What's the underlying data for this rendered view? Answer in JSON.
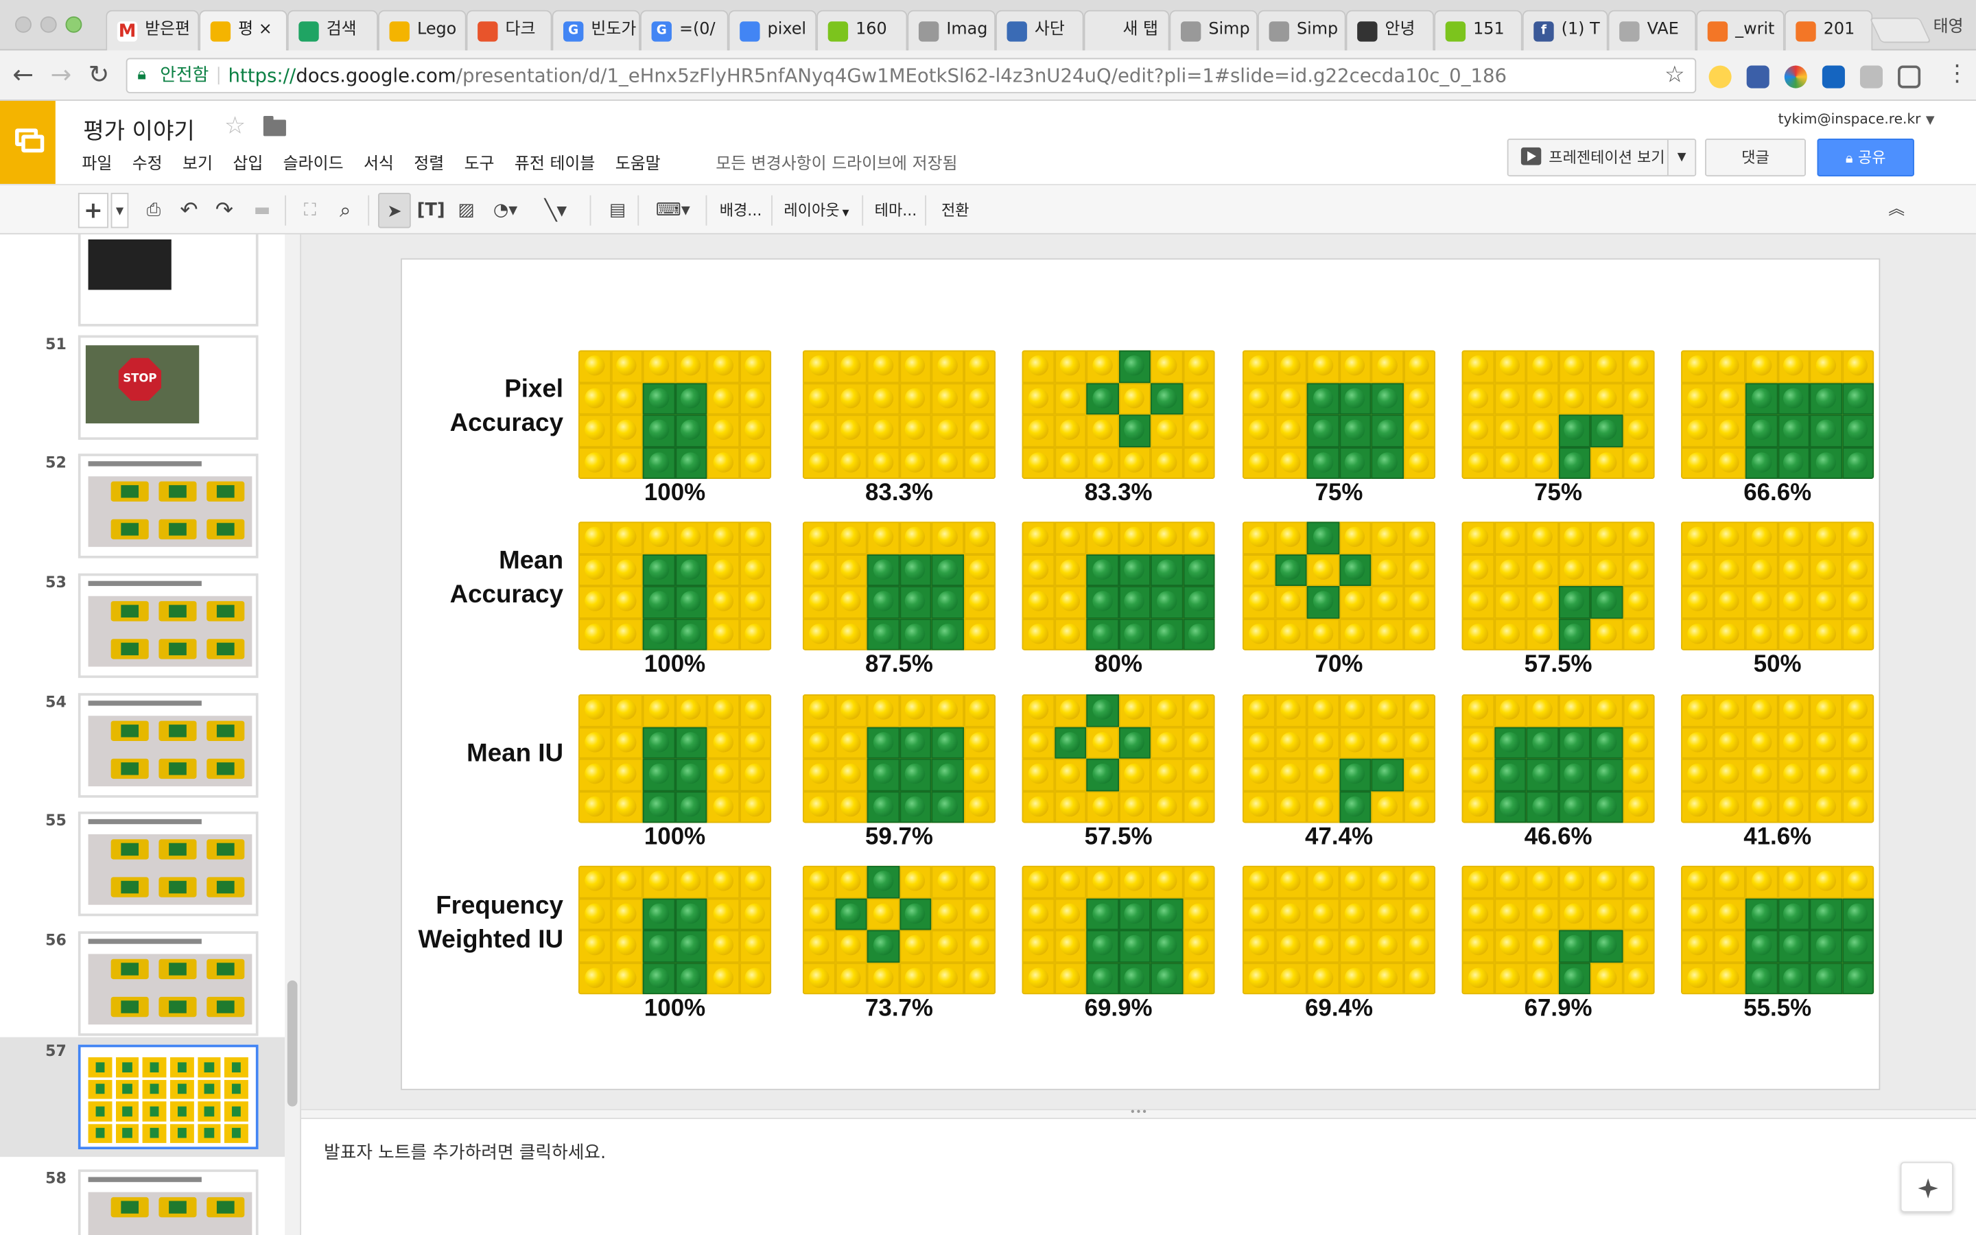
{
  "browser": {
    "tabs": [
      {
        "title": "받은편",
        "icon": "gmail-icon",
        "color": "#ffffff",
        "glyph": "M"
      },
      {
        "title": "평 ×",
        "icon": "slides-icon",
        "color": "#f4b400",
        "glyph": "",
        "active": true
      },
      {
        "title": "검색 ",
        "icon": "drive-icon",
        "color": "#1fa463",
        "glyph": ""
      },
      {
        "title": "Lego",
        "icon": "slides-icon",
        "color": "#f4b400",
        "glyph": ""
      },
      {
        "title": "다크 ",
        "icon": "brave-icon",
        "color": "#e8542b",
        "glyph": ""
      },
      {
        "title": "빈도가",
        "icon": "google-icon",
        "color": "#4285f4",
        "glyph": "G"
      },
      {
        "title": "=(0/",
        "icon": "google-icon",
        "color": "#4285f4",
        "glyph": "G"
      },
      {
        "title": "pixel",
        "icon": "docs-icon",
        "color": "#4285f4",
        "glyph": ""
      },
      {
        "title": "160",
        "icon": "smiley-icon",
        "color": "#7cc41d",
        "glyph": ""
      },
      {
        "title": "Imag",
        "icon": "page-icon",
        "color": "#999999",
        "glyph": ""
      },
      {
        "title": "사단",
        "icon": "kcys-icon",
        "color": "#3a6bb5",
        "glyph": ""
      },
      {
        "title": "새 탭",
        "icon": "blank-icon",
        "color": "#e8e8e8",
        "glyph": ""
      },
      {
        "title": "Simp",
        "icon": "page-icon",
        "color": "#999999",
        "glyph": ""
      },
      {
        "title": "Simp",
        "icon": "page-icon",
        "color": "#999999",
        "glyph": ""
      },
      {
        "title": "안녕",
        "icon": "logo-icon",
        "color": "#333333",
        "glyph": ""
      },
      {
        "title": "151",
        "icon": "smiley-icon",
        "color": "#7cc41d",
        "glyph": ""
      },
      {
        "title": "(1) T",
        "icon": "facebook-icon",
        "color": "#3b5998",
        "glyph": "f"
      },
      {
        "title": "VAE",
        "icon": "image-icon",
        "color": "#aaaaaa",
        "glyph": ""
      },
      {
        "title": "_writ",
        "icon": "jupyter-icon",
        "color": "#f37626",
        "glyph": ""
      },
      {
        "title": "201",
        "icon": "jupyter-icon",
        "color": "#f37626",
        "glyph": ""
      }
    ],
    "profile": "태영",
    "secure_label": "안전함",
    "url_scheme": "https://",
    "url_host": "docs.google.com",
    "url_path": "/presentation/d/1_eHnx5zFlyHR5nfANyq4Gw1MEotkSl62-l4z3nU24uQ/edit?pli=1#slide=id.g22cecda10c_0_186"
  },
  "docs": {
    "title": "평가 이야기",
    "menu": [
      "파일",
      "수정",
      "보기",
      "삽입",
      "슬라이드",
      "서식",
      "정렬",
      "도구",
      "퓨전 테이블",
      "도움말"
    ],
    "save_status": "모든 변경사항이 드라이브에 저장됨",
    "account": "tykim@inspace.re.kr",
    "present_label": "프레젠테이션 보기",
    "comments_label": "댓글",
    "share_label": "공유",
    "toolbar_text": [
      "배경...",
      "레이아웃",
      "테마...",
      "전환"
    ]
  },
  "filmstrip": {
    "slides": [
      {
        "num": "",
        "kind": "dark"
      },
      {
        "num": "51",
        "kind": "stop"
      },
      {
        "num": "52",
        "kind": "lego"
      },
      {
        "num": "53",
        "kind": "lego"
      },
      {
        "num": "54",
        "kind": "lego"
      },
      {
        "num": "55",
        "kind": "lego"
      },
      {
        "num": "56",
        "kind": "lego"
      },
      {
        "num": "57",
        "kind": "grid",
        "active": true
      },
      {
        "num": "58",
        "kind": "lego"
      }
    ]
  },
  "slide": {
    "metrics": [
      {
        "label": "Pixel\nAccuracy",
        "values": [
          "100%",
          "83.3%",
          "83.3%",
          "75%",
          "75%",
          "66.6%"
        ]
      },
      {
        "label": "Mean\nAccuracy",
        "values": [
          "100%",
          "87.5%",
          "80%",
          "70%",
          "57.5%",
          "50%"
        ]
      },
      {
        "label": "Mean IU",
        "values": [
          "100%",
          "59.7%",
          "57.5%",
          "47.4%",
          "46.6%",
          "41.6%"
        ]
      },
      {
        "label": "Frequency\nWeighted IU",
        "values": [
          "100%",
          "73.7%",
          "69.9%",
          "69.4%",
          "67.9%",
          "55.5%"
        ]
      }
    ],
    "patterns": {
      "gt": [
        "000000",
        "002200",
        "002200",
        "002200"
      ],
      "none": [
        "000000",
        "000000",
        "000000",
        "000000"
      ],
      "cross": [
        "000200",
        "002020",
        "000200",
        "000000"
      ],
      "block3": [
        "000000",
        "002220",
        "002220",
        "002220"
      ],
      "corner": [
        "000000",
        "000000",
        "000220",
        "000200"
      ],
      "wide4": [
        "000000",
        "002222",
        "002222",
        "002222"
      ],
      "crossR": [
        "000200",
        "002020",
        "000200",
        "000000"
      ],
      "block3L": [
        "000000",
        "022200",
        "022200",
        "022200"
      ],
      "cornerL": [
        "000000",
        "000000",
        "002200",
        "002000"
      ],
      "block4": [
        "000000",
        "022220",
        "022220",
        "022220"
      ],
      "crossC": [
        "002000",
        "020200",
        "002000",
        "000000"
      ],
      "cornerC": [
        "000000",
        "000000",
        "000220",
        "000200"
      ]
    },
    "grid": [
      [
        "gt",
        "none",
        "cross",
        "block3",
        "corner",
        "wide4"
      ],
      [
        "gt",
        "block3",
        "wide4",
        "crossC",
        "corner",
        "none"
      ],
      [
        "gt",
        "block3",
        "crossC",
        "cornerC",
        "block4",
        "none"
      ],
      [
        "gt",
        "crossC",
        "block3",
        "none",
        "corner",
        "wide4"
      ]
    ]
  },
  "notes": {
    "placeholder": "발표자 노트를 추가하려면 클릭하세요."
  }
}
